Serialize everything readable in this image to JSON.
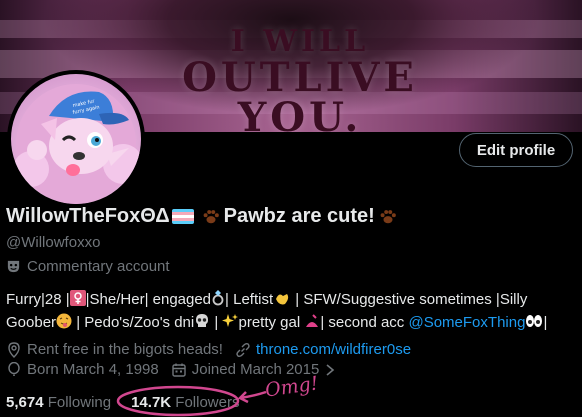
{
  "banner": {
    "lines": [
      "I WILL",
      "OUTLIVE",
      "YOU."
    ]
  },
  "profile": {
    "edit_label": "Edit profile",
    "display_name": "WillowTheFoxΘΔ",
    "display_name_suffix": " Pawbz are cute!",
    "handle": "@Willowfoxxo",
    "commentary": "Commentary account",
    "bio_parts": {
      "p1": "Furry|28 |",
      "p2": "|She/Her| engaged",
      "p3": "| Leftist",
      "p4": " | SFW/Suggestive sometimes |Silly",
      "p5": "Goober",
      "p6": " | Pedo's/Zoo's dni",
      "p7": " | ",
      "p8": "pretty gal ",
      "p9": "| second acc ",
      "mention": "@SomeFoxThing",
      "p10": "|"
    },
    "location": "Rent free in the bigots heads!",
    "website": "throne.com/wildfirer0se",
    "born": "Born March 4, 1998",
    "joined": "Joined March 2015",
    "following_count": "5,674",
    "following_label": "Following",
    "followers_count": "14.7K",
    "followers_label": "Followers"
  },
  "annotation": {
    "text": "Omg!"
  },
  "icons": [
    "comedy-mask-icon",
    "location-pin-icon",
    "link-icon",
    "balloon-icon",
    "calendar-icon",
    "chevron-right-icon"
  ],
  "colors": {
    "accent": "#1d9bf0",
    "muted": "#71767b",
    "text": "#e7e9ea",
    "annotation": "#d1478f"
  }
}
